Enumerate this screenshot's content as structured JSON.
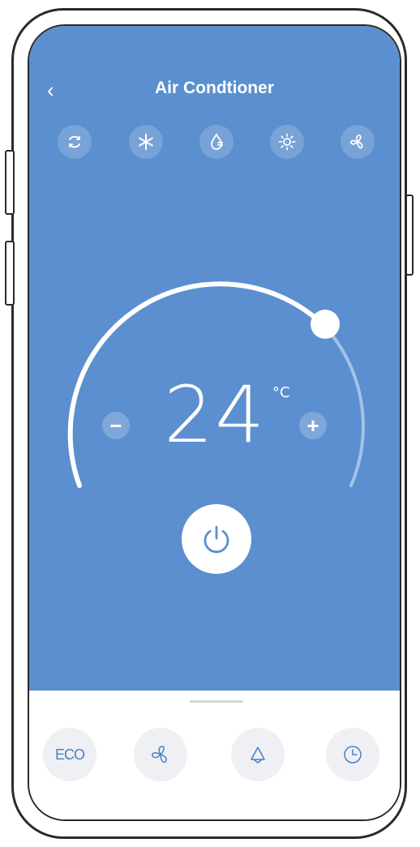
{
  "header": {
    "back_icon": "chevron-left-icon",
    "title": "Air Condtioner"
  },
  "modes": [
    {
      "name": "auto-mode",
      "icon": "cycle-icon"
    },
    {
      "name": "cool-mode",
      "icon": "snowflake-icon"
    },
    {
      "name": "dry-mode",
      "icon": "drop-icon"
    },
    {
      "name": "heat-mode",
      "icon": "sun-icon"
    },
    {
      "name": "fan-mode",
      "icon": "fan-icon"
    }
  ],
  "thermostat": {
    "temperature": "24",
    "unit": "°C",
    "decrease_label": "−",
    "increase_label": "+"
  },
  "bottom_tools": {
    "eco_label": "ECO",
    "items": [
      "eco",
      "fan-speed-icon",
      "swing-icon",
      "timer-icon"
    ]
  },
  "colors": {
    "accent": "#5b8fcf",
    "eco_text": "#4a7fc8"
  }
}
